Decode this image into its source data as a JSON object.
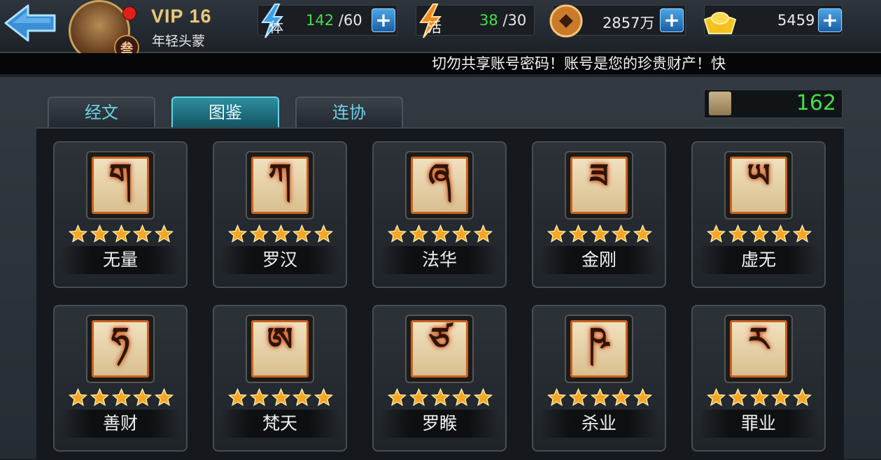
{
  "header": {
    "back_icon": "back-arrow-icon",
    "vip_label": "VIP 16",
    "player_title": "年轻头蒙",
    "rank_badge": "叁",
    "stamina": {
      "icon_label": "体",
      "current": "142",
      "max": "/60"
    },
    "activity": {
      "icon_label": "活",
      "current": "38",
      "max": "/30"
    },
    "copper": {
      "value": "2857万"
    },
    "gold": {
      "value": "5459"
    },
    "plus_symbol": "+"
  },
  "ticker": {
    "text": "切勿共享账号密码！账号是您的珍贵财产！快"
  },
  "tabs": [
    {
      "label": "经文",
      "active": false
    },
    {
      "label": "图鉴",
      "active": true
    },
    {
      "label": "连协",
      "active": false
    }
  ],
  "collection_count": "162",
  "colors": {
    "accent_green": "#3fe04a",
    "tab_active": "#2d8fa0",
    "tile_border": "#c8621d",
    "star": "#f6a623"
  },
  "cards": [
    {
      "name": "无量",
      "glyph": "ག",
      "stars": 5
    },
    {
      "name": "罗汉",
      "glyph": "ཀ",
      "stars": 5
    },
    {
      "name": "法华",
      "glyph": "ཞ",
      "stars": 5
    },
    {
      "name": "金刚",
      "glyph": "ཟ",
      "stars": 5
    },
    {
      "name": "虚无",
      "glyph": "ཡ",
      "stars": 5
    },
    {
      "name": "善财",
      "glyph": "ཧ",
      "stars": 5
    },
    {
      "name": "梵天",
      "glyph": "ཨ",
      "stars": 5
    },
    {
      "name": "罗睺",
      "glyph": "ཙ",
      "stars": 5
    },
    {
      "name": "杀业",
      "glyph": "ཥ",
      "stars": 5
    },
    {
      "name": "罪业",
      "glyph": "ར",
      "stars": 5
    }
  ]
}
